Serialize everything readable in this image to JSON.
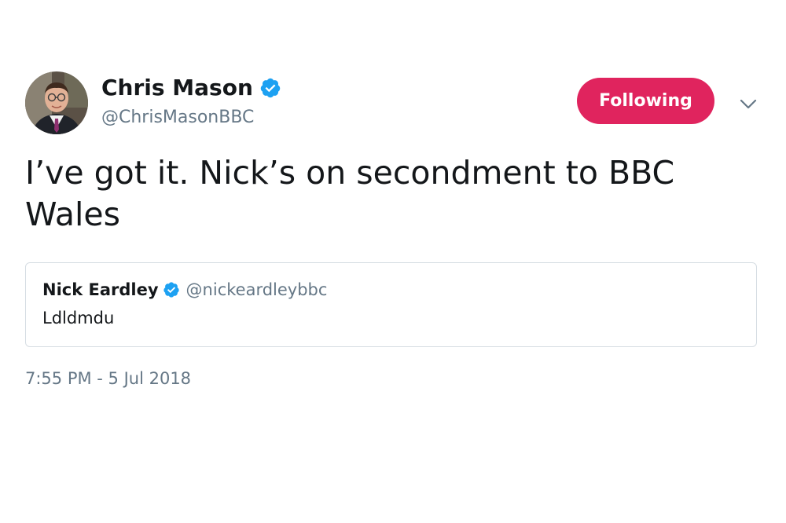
{
  "tweet": {
    "author": {
      "name": "Chris Mason",
      "handle": "@ChrisMasonBBC",
      "verified": true,
      "avatar_icon": "user-avatar-photo"
    },
    "follow_button_label": "Following",
    "menu_icon": "chevron-down-icon",
    "text": "I’ve got it. Nick’s on secondment to BBC Wales",
    "quoted_tweet": {
      "name": "Nick Eardley",
      "handle": "@nickeardleybbc",
      "verified": true,
      "text": "Ldldmdu"
    },
    "timestamp": "7:55 PM - 5 Jul 2018"
  },
  "colors": {
    "follow_button": "#e0245e",
    "verified_badge": "#1da1f2",
    "secondary_text": "#657786",
    "primary_text": "#14171a",
    "card_border": "#d6dde3"
  }
}
